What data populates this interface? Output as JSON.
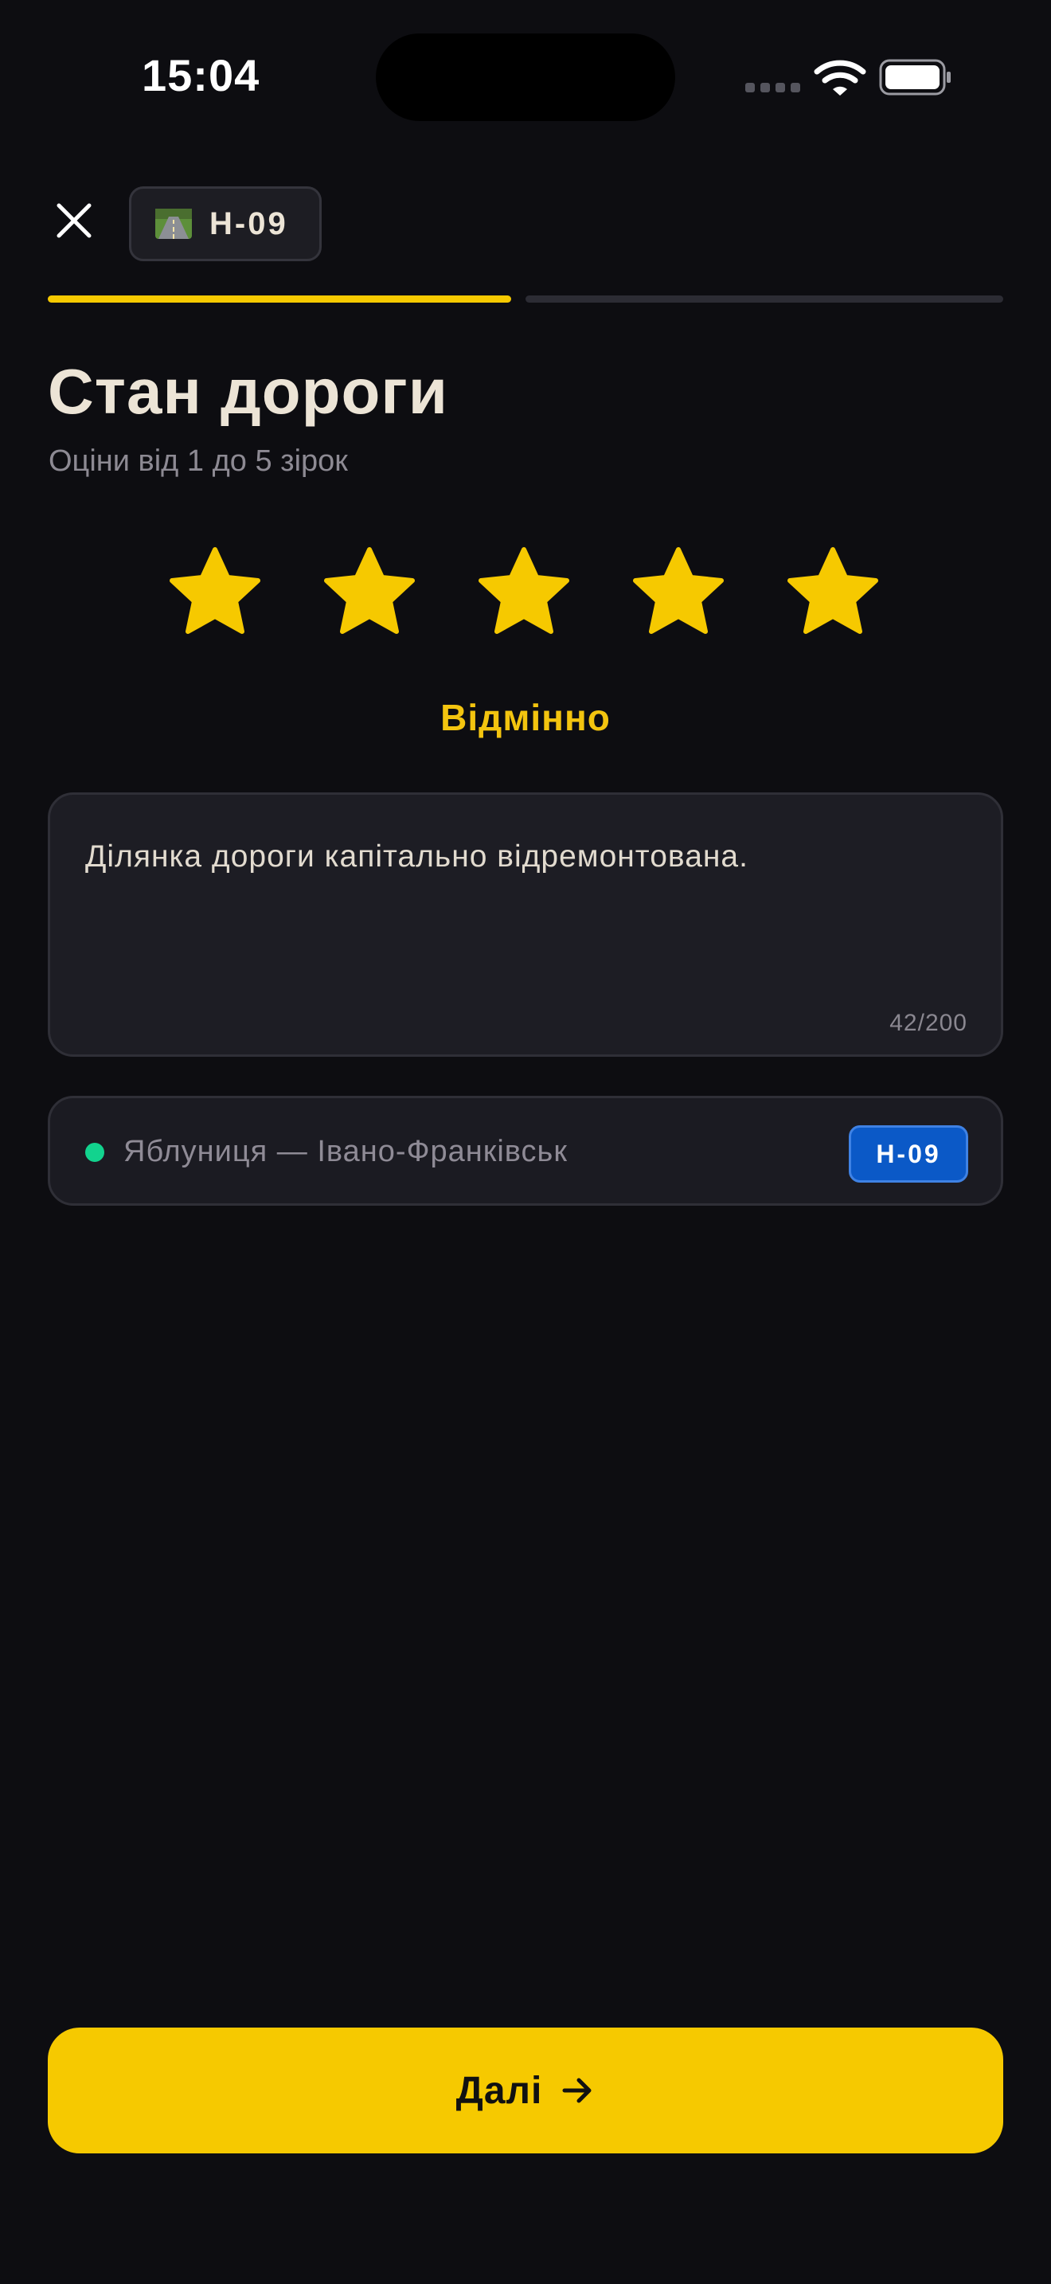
{
  "status_bar": {
    "time": "15:04"
  },
  "header": {
    "route_chip_label": "Н-09"
  },
  "progress": {
    "current_step": 1,
    "total_steps": 2
  },
  "page": {
    "title": "Стан дороги",
    "subtitle": "Оціни від 1 до 5 зірок"
  },
  "rating": {
    "value": 5,
    "max": 5,
    "label": "Відмінно",
    "color": "#f6c900"
  },
  "comment": {
    "value": "Ділянка дороги капітально відремонтована.",
    "counter": "42/200"
  },
  "route": {
    "name": "Яблуниця — Івано-Франківськ",
    "road_code": "Н-09",
    "status_color": "#12d38e",
    "badge_color": "#0b59c7"
  },
  "footer": {
    "next_label": "Далі"
  },
  "icons": [
    "close-icon",
    "road-icon",
    "star-icon",
    "arrow-right-icon",
    "wifi-icon",
    "battery-icon",
    "signal-icon"
  ],
  "colors": {
    "accent": "#f6c900",
    "background": "#0d0d11"
  }
}
